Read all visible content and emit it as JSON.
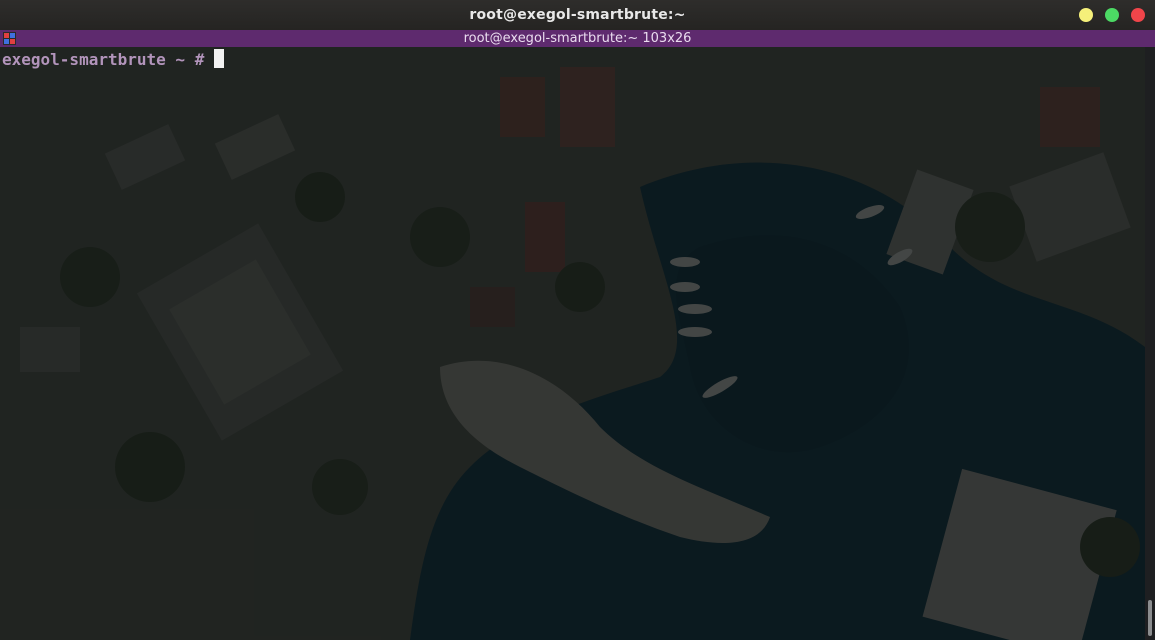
{
  "window": {
    "title": "root@exegol-smartbrute:~",
    "controls": {
      "minimize_color": "#f5f07a",
      "maximize_color": "#4cd964",
      "close_color": "#f0454a"
    }
  },
  "tab": {
    "label": "root@exegol-smartbrute:~ 103x26",
    "icon": "terminal-icon"
  },
  "terminal": {
    "prompt_host": "exegol-smartbrute",
    "prompt_path": "~",
    "prompt_symbol": "#",
    "prompt_color": "#b294bb",
    "background": "aerial-harbor-wallpaper"
  },
  "scrollbar": {
    "position": "bottom"
  }
}
